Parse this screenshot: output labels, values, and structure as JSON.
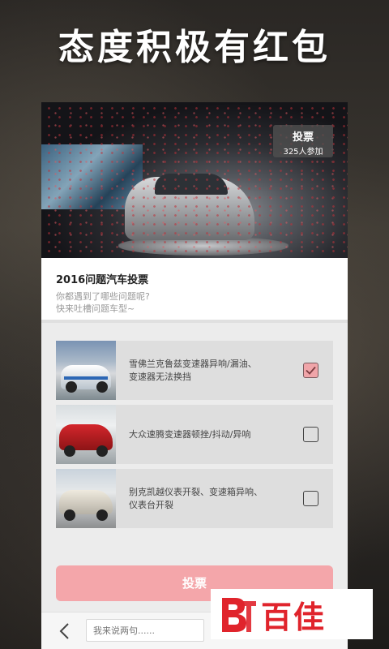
{
  "headline": "态度积极有红包",
  "hero": {
    "badge_title": "投票",
    "badge_count": "325人参加"
  },
  "info": {
    "title": "2016问题汽车投票",
    "desc_line1": "你都遇到了哪些问题呢?",
    "desc_line2": "快来吐槽问题车型~"
  },
  "options": [
    {
      "line1": "雪佛兰克鲁兹变速器异响/漏油、",
      "line2": "变速器无法换挡",
      "checked": true
    },
    {
      "line1": "大众速腾变速器顿挫/抖动/异响",
      "line2": "",
      "checked": false
    },
    {
      "line1": "别克凯越仪表开裂、变速箱异响、",
      "line2": "仪表台开裂",
      "checked": false
    }
  ],
  "vote_button": "投票",
  "comment": {
    "placeholder": "我来说两句......"
  },
  "watermark": {
    "text": "百佳"
  },
  "colors": {
    "accent_pink": "#f4a6aa",
    "brand_red": "#e0242c"
  }
}
